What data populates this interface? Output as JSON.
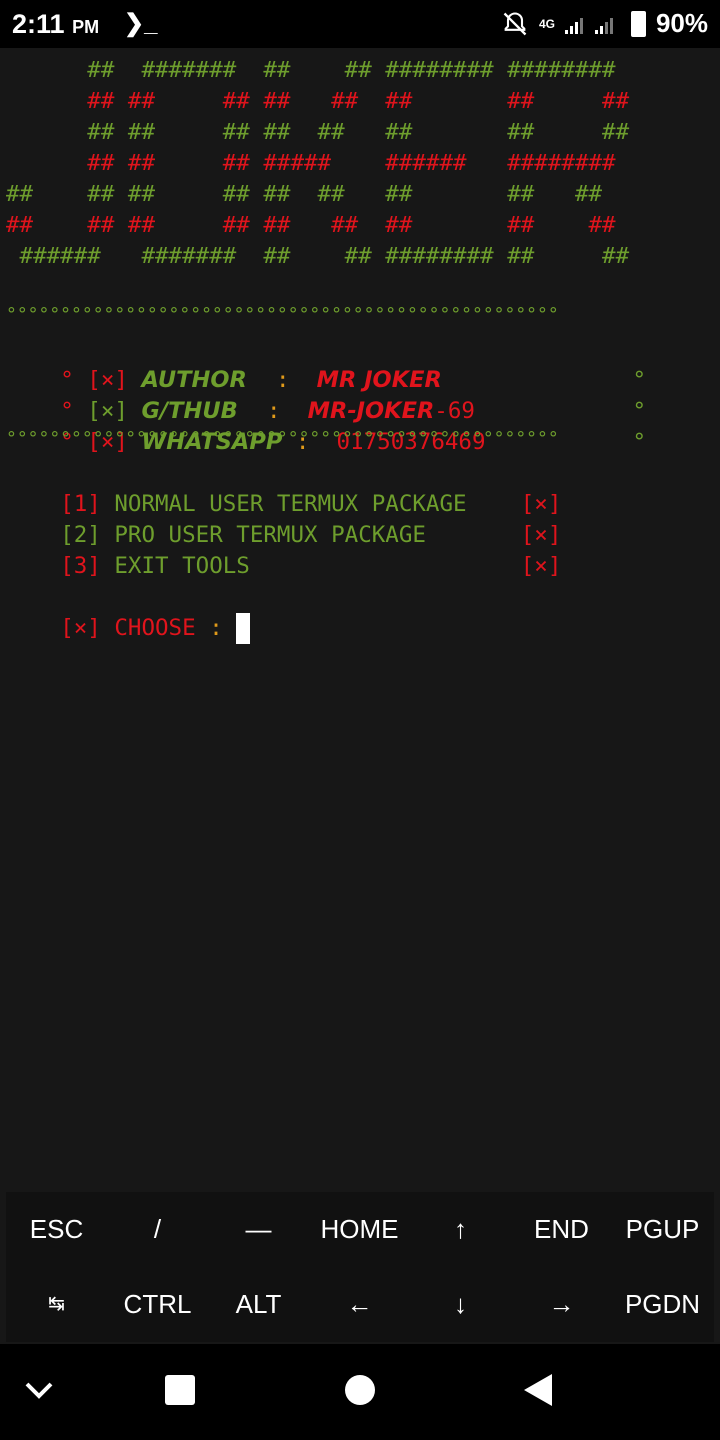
{
  "status_bar": {
    "time": "2:11",
    "ampm": "PM",
    "terminal_glyph": "❯_",
    "network": "4G",
    "battery": "90%"
  },
  "banner": {
    "line1": "      ##  #######  ##    ## ######## ########",
    "line2": "      ## ##     ## ##   ##  ##       ##     ##",
    "line3": "      ## ##     ## ##  ##   ##       ##     ##",
    "line4": "      ## ##     ## #####    ######   ########",
    "line5": "##    ## ##     ## ##  ##   ##       ##   ##",
    "line6": "##    ## ##     ## ##   ##  ##       ##    ##",
    "line7": " ######   #######  ##    ## ######## ##     ##"
  },
  "divider": "°°°°°°°°°°°°°°°°°°°°°°°°°°°°°°°°°°°°°°°°°°°°°°°°°°°",
  "info": [
    {
      "mark": "°",
      "bracket": "[×]",
      "label": "AUTHOR  ",
      "sep": " : ",
      "value": "MR JOKER",
      "value_suffix": ""
    },
    {
      "mark": "°",
      "bracket": "[×]",
      "label": "G/THUB  ",
      "sep": " : ",
      "value": "MR-JOKER",
      "value_suffix": "-69"
    },
    {
      "mark": "°",
      "bracket": "[×]",
      "label": "WHATSAPP",
      "sep": " : ",
      "value": "",
      "value_suffix": "01750376469"
    }
  ],
  "menu": [
    {
      "num": "[1]",
      "label": "NORMAL USER TERMUX PACKAGE",
      "tag": "[×]"
    },
    {
      "num": "[2]",
      "label": "PRO USER TERMUX PACKAGE   ",
      "tag": "[×]"
    },
    {
      "num": "[3]",
      "label": "EXIT TOOLS                ",
      "tag": "[×]"
    }
  ],
  "prompt": {
    "bracket": "[×]",
    "label": "CHOOSE",
    "sep": ":"
  },
  "extra_keys": {
    "row1": [
      "ESC",
      "/",
      "—",
      "HOME",
      "↑",
      "END",
      "PGUP"
    ],
    "row2": [
      "↹",
      "CTRL",
      "ALT",
      "←",
      "↓",
      "→",
      "PGDN"
    ]
  },
  "colors": {
    "green": "#6e9e2d",
    "red": "#e0141c",
    "yellow": "#e09a1a",
    "background": "#171717"
  }
}
